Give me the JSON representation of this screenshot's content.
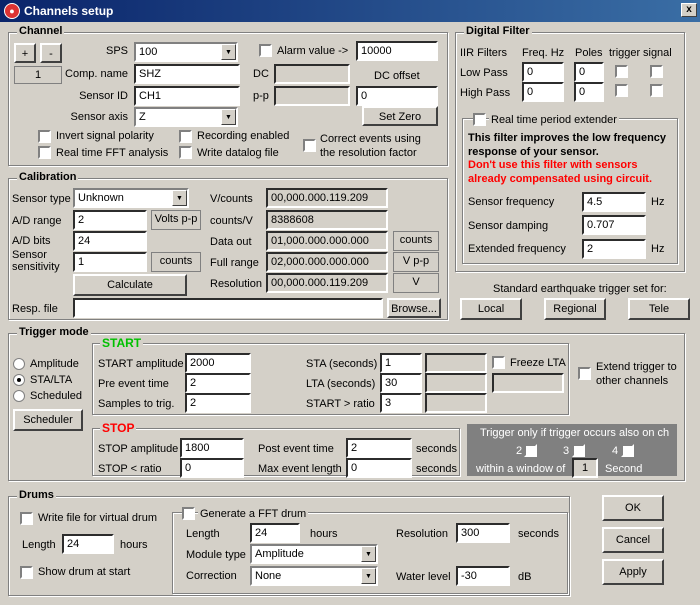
{
  "window": {
    "title": "Channels setup",
    "app_icon": "app-icon",
    "close_glyph": "x"
  },
  "channel": {
    "title": "Channel",
    "plus": "+",
    "minus": "-",
    "channel_number": "1",
    "sps_label": "SPS",
    "sps_value": "100",
    "alarm_label": "Alarm value ->",
    "alarm_value": "10000",
    "comp_name_label": "Comp. name",
    "comp_name_value": "SHZ",
    "dc_label": "DC",
    "dc_offset_label": "DC offset",
    "sensor_id_label": "Sensor ID",
    "sensor_id_value": "CH1",
    "pp_label": "p-p",
    "dc_offset_value": "0",
    "sensor_axis_label": "Sensor axis",
    "sensor_axis_value": "Z",
    "set_zero": "Set Zero",
    "invert": "Invert signal polarity",
    "recording": "Recording enabled",
    "correct_events": "Correct events using the resolution factor",
    "fft": "Real time FFT analysis",
    "datalog": "Write datalog file"
  },
  "digital_filter": {
    "title": "Digital Filter",
    "iir": "IIR Filters",
    "freq": "Freq. Hz",
    "poles": "Poles",
    "trigger": "trigger",
    "signal": "signal",
    "lowpass": "Low Pass",
    "lp_freq": "0",
    "lp_poles": "0",
    "highpass": "High Pass",
    "hp_freq": "0",
    "hp_poles": "0",
    "rt_extender": "Real time period extender",
    "desc": "This filter improves the low frequency response of your sensor.",
    "warning": "Don't use this filter with sensors already compensated using circuit.",
    "warning_color": "#ff0000",
    "sensor_freq_label": "Sensor frequency",
    "sensor_freq_value": "4.5",
    "hz": "Hz",
    "damping_label": "Sensor damping",
    "damping_value": "0.707",
    "ext_freq_label": "Extended frequency",
    "ext_freq_value": "2"
  },
  "trigger_set": {
    "title": "Standard earthquake trigger set for:",
    "local": "Local",
    "regional": "Regional",
    "tele": "Tele"
  },
  "calibration": {
    "title": "Calibration",
    "sensor_type_label": "Sensor type",
    "sensor_type_value": "Unknown",
    "vcounts_label": "V/counts",
    "vcounts_value": "00,000.000.119.209",
    "ad_range_label": "A/D range",
    "ad_range_value": "2",
    "volts_pp": "Volts p-p",
    "countsv_label": "counts/V",
    "countsv_value": "8388608",
    "ad_bits_label": "A/D bits",
    "ad_bits_value": "24",
    "dataout_label": "Data out",
    "dataout_value": "01,000.000.000.000",
    "counts": "counts",
    "sensitivity_label": "Sensor sensitivity",
    "sensitivity_value": "1",
    "fullrange_label": "Full range",
    "fullrange_value": "02,000.000.000.000",
    "vpp": "V p-p",
    "calculate": "Calculate",
    "resolution_label": "Resolution",
    "resolution_value": "00,000.000.119.209",
    "v": "V",
    "resp_label": "Resp. file",
    "resp_value": "",
    "browse": "Browse..."
  },
  "trigger_mode": {
    "title": "Trigger mode",
    "amplitude": "Amplitude",
    "sta_lta": "STA/LTA",
    "scheduled": "Scheduled",
    "scheduler": "Scheduler",
    "start_title": "START",
    "start_color": "#00c000",
    "start_amp_label": "START amplitude",
    "start_amp_value": "2000",
    "pre_event_label": "Pre event time",
    "pre_event_value": "2",
    "samples_label": "Samples to trig.",
    "samples_value": "2",
    "sta_label": "STA (seconds)",
    "sta_value": "1",
    "lta_label": "LTA (seconds)",
    "lta_value": "30",
    "ratio_label": "START > ratio",
    "ratio_value": "3",
    "freeze_lta": "Freeze LTA",
    "extend_trigger": "Extend trigger to other channels",
    "stop_title": "STOP",
    "stop_color": "#ff0000",
    "stop_amp_label": "STOP amplitude",
    "stop_amp_value": "1800",
    "stop_ratio_label": "STOP < ratio",
    "stop_ratio_value": "0",
    "post_event_label": "Post event time",
    "post_event_value": "2",
    "max_event_label": "Max event length",
    "max_event_value": "0",
    "seconds": "seconds",
    "only_if": "Trigger only if trigger occurs also on ch",
    "ch2": "2",
    "ch3": "3",
    "ch4": "4",
    "within": "within a window of",
    "window_value": "1",
    "second": "Second"
  },
  "drums": {
    "title": "Drums",
    "write_file": "Write file for virtual drum",
    "length_label": "Length",
    "length_value": "24",
    "hours": "hours",
    "show_drum": "Show drum at start",
    "gen_fft": "Generate a FFT drum",
    "fft_length_label": "Length",
    "fft_length_value": "24",
    "fft_hours": "hours",
    "resolution_label": "Resolution",
    "resolution_value": "300",
    "resolution_unit": "seconds",
    "module_label": "Module type",
    "module_value": "Amplitude",
    "correction_label": "Correction",
    "correction_value": "None",
    "water_label": "Water level",
    "water_value": "-30",
    "water_unit": "dB"
  },
  "buttons": {
    "ok": "OK",
    "cancel": "Cancel",
    "apply": "Apply"
  }
}
